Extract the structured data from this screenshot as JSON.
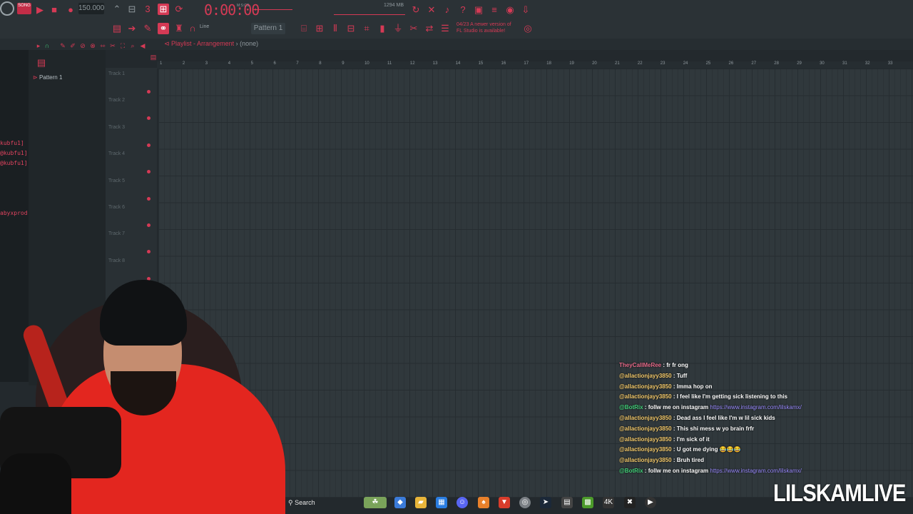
{
  "toolbar": {
    "song_badge": "SONG",
    "bpm": "150.000",
    "time": "0:00:00",
    "time_unit": "M:S:CS",
    "memory": "1294 MB",
    "notice": "04/23 A newer version of\nFL Studio is available!",
    "pattern": "Pattern 1",
    "snap": "Line"
  },
  "playlist": {
    "title": "Playlist - Arrangement",
    "sep": "›",
    "sub": "(none)",
    "picker_item": "Pattern 1",
    "tracks": [
      "Track 1",
      "Track 2",
      "Track 3",
      "Track 4",
      "Track 5",
      "Track 6",
      "Track 7",
      "Track 8"
    ],
    "bars": [
      "1",
      "2",
      "3",
      "4",
      "5",
      "6",
      "7",
      "8",
      "9",
      "10",
      "11",
      "12",
      "13",
      "14",
      "15",
      "16",
      "17",
      "18",
      "19",
      "20",
      "21",
      "22",
      "23",
      "24",
      "25",
      "26",
      "27",
      "28",
      "29",
      "30",
      "31",
      "32",
      "33"
    ]
  },
  "sidebar_chat": [
    "kubfu1]",
    "@kubfu1]",
    "@kubfu1]",
    "abyxprod"
  ],
  "chat": [
    {
      "user": "TheyCallMeRee",
      "msg": " : fr fr ong"
    },
    {
      "user": "@allactionjayy3850",
      "msg": " : Tuff"
    },
    {
      "user": "@allactionjayy3850",
      "msg": " : Imma hop on"
    },
    {
      "user": "@allactionjayy3850",
      "msg": " : I feel like I'm getting sick listening to this"
    },
    {
      "user": "@BotRix",
      "msg": " : follw me on instagram ",
      "link": "https://www.instagram.com/lilskamx/"
    },
    {
      "user": "@allactionjayy3850",
      "msg": " : Dead ass I feel like I'm w lil sick kids"
    },
    {
      "user": "@allactionjayy3850",
      "msg": " : This shi mess w yo brain frfr"
    },
    {
      "user": "@allactionjayy3850",
      "msg": " : I'm sick of it"
    },
    {
      "user": "@allactionjayy3850",
      "msg": " : U got me dying 😂😂😂"
    },
    {
      "user": "@allactionjayy3850",
      "msg": " : Bruh tired"
    },
    {
      "user": "@BotRix",
      "msg": " : follw me on instagram ",
      "link": "https://www.instagram.com/lilskamx/"
    }
  ],
  "taskbar": {
    "search": "Search"
  },
  "brand": "LILSKAMLIVE",
  "colors": {
    "accent": "#d53a55",
    "grid": "#30383c",
    "panel": "#2b3236"
  }
}
